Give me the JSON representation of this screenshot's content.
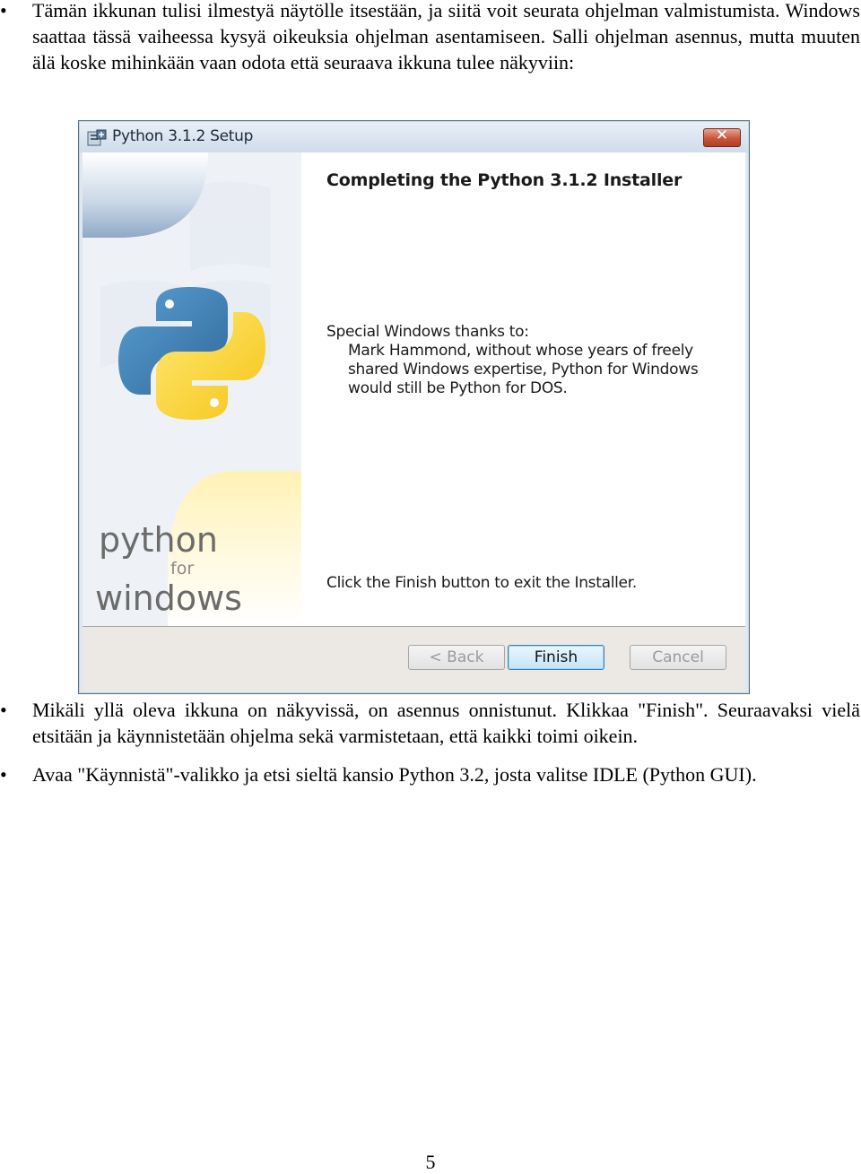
{
  "bullets": [
    "Tämän ikkunan tulisi ilmestyä näytölle itsestään, ja siitä voit seurata ohjelman valmistumista. Windows saattaa tässä vaiheessa kysyä oikeuksia ohjelman asentamiseen. Salli ohjelman asennus, mutta muuten älä koske mihinkään vaan odota että seuraava ikkuna tulee näkyviin:",
    "Mikäli yllä oleva ikkuna on näkyvissä, on asennus onnistunut. Klikkaa \"Finish\". Seuraavaksi vielä etsitään ja käynnistetään ohjelma sekä varmistetaan, että kaikki toimi oikein.",
    "Avaa \"Käynnistä\"-valikko ja etsi sieltä kansio Python 3.2, josta valitse IDLE (Python GUI)."
  ],
  "bullet_symbol": "•",
  "installer": {
    "title": "Python 3.1.2 Setup",
    "close_label": "✕",
    "heading": "Completing the Python 3.1.2 Installer",
    "thanks_intro": "Special Windows thanks to:",
    "thanks_body": "Mark Hammond, without whose years of freely shared Windows expertise, Python for Windows would still be Python for DOS.",
    "finish_message": "Click the Finish button to exit the Installer.",
    "logo_text": {
      "top": "python",
      "middle": "for",
      "bottom": "windows"
    },
    "buttons": {
      "back": "< Back",
      "finish": "Finish",
      "cancel": "Cancel"
    },
    "colors": {
      "python_blue": "#3b6fa5",
      "python_yellow": "#f7cc3b",
      "title_bg": "#dbe5f0",
      "close": "#c8553d"
    }
  },
  "page_number": "5"
}
